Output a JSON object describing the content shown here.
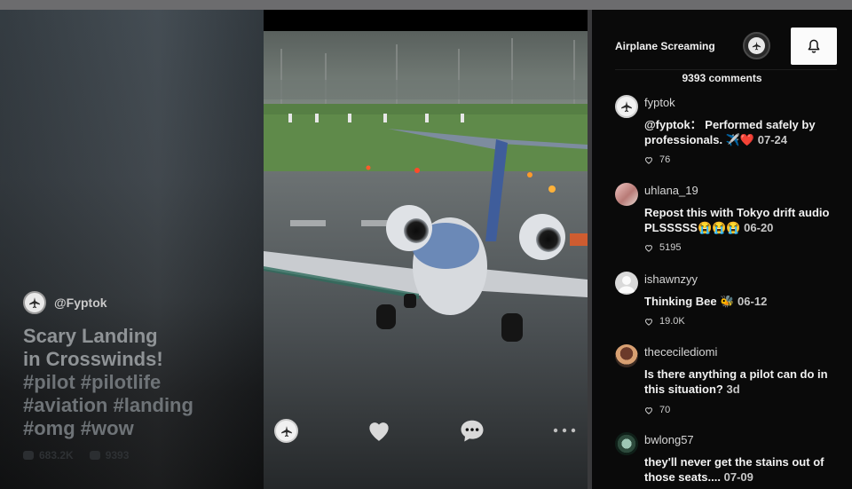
{
  "post": {
    "author": "@Fyptok",
    "caption_lines": [
      "Scary Landing",
      "in Crosswinds!"
    ],
    "hashtag_lines": [
      "#pilot #pilotlife",
      "#aviation #landing",
      "#omg #wow"
    ],
    "ghost_likes": "683.2K",
    "ghost_comments": "9393"
  },
  "panel": {
    "sound_title": "Airplane Screaming",
    "comment_count": "9393 comments"
  },
  "comments": [
    {
      "user": "fyptok",
      "text": "@fyptok： Performed safely by professionals. ✈️❤️",
      "date": "07-24",
      "likes": "76",
      "avatar": "jet"
    },
    {
      "user": "uhlana_19",
      "text": "Repost this with Tokyo drift audio PLSSSSS😭😭😭",
      "date": "06-20",
      "likes": "5195",
      "avatar": "photo-pink"
    },
    {
      "user": "ishawnzyy",
      "text": "Thinking Bee 🐝",
      "date": "06-12",
      "likes": "19.0K",
      "avatar": "default"
    },
    {
      "user": "thececilediomi",
      "text": "Is there anything a pilot can do in this situation?",
      "date": "3d",
      "likes": "70",
      "avatar": "photo-brown"
    },
    {
      "user": "bwlong57",
      "text": "they'll never get the stains out of those seats....",
      "date": "07-09",
      "likes": "",
      "avatar": "photo-green"
    }
  ],
  "colors": {
    "accent_like": "#d9d9d9",
    "heart_red": "#e8283c"
  },
  "icons": {
    "like": "heart-icon",
    "comment": "comment-bubble-icon",
    "more": "ellipsis-icon",
    "bell": "bell-icon",
    "sound": "music-disc-icon"
  }
}
